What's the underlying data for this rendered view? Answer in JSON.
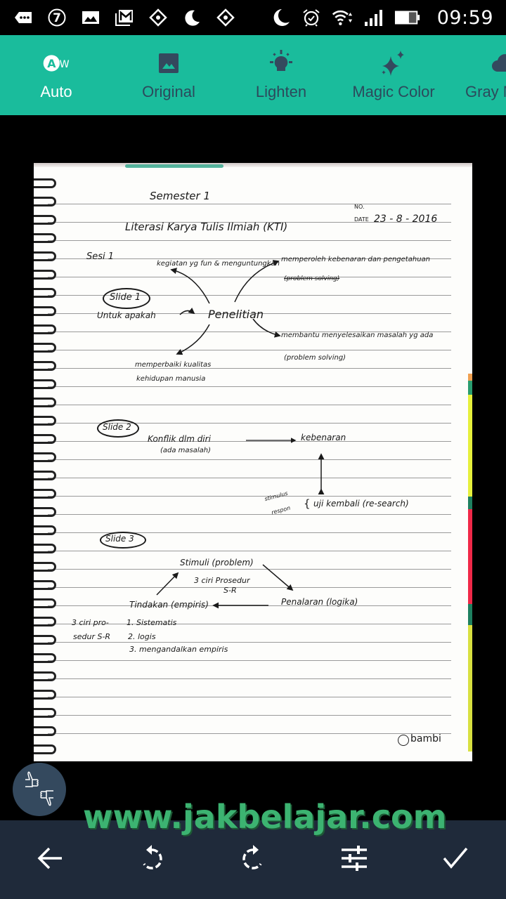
{
  "status_bar": {
    "time": "09:59",
    "left_icons": [
      "chat-more-icon",
      "notification-7-icon",
      "gallery-icon",
      "gmail-icon",
      "diamond-app-icon",
      "night-mode-icon",
      "diamond-app-icon"
    ],
    "right_icons": [
      "night-mode-icon",
      "alarm-icon",
      "wifi-icon",
      "signal-icon",
      "battery-icon"
    ],
    "notification_badge": "7"
  },
  "filter_bar": {
    "items": [
      {
        "label": "Auto",
        "icon": "auto-wb-icon",
        "active": true
      },
      {
        "label": "Original",
        "icon": "image-icon",
        "active": false
      },
      {
        "label": "Lighten",
        "icon": "lightbulb-icon",
        "active": false
      },
      {
        "label": "Magic Color",
        "icon": "sparkle-icon",
        "active": false
      },
      {
        "label": "Gray Mode",
        "icon": "cloud-icon",
        "active": false
      }
    ],
    "active_color": "#ffffff",
    "inactive_color": "#2c4a5c",
    "background": "#1abc9c"
  },
  "document": {
    "header": {
      "title": "Semester 1",
      "subject": "Literasi Karya Tulis Ilmiah (KTI)",
      "no_label": "NO.",
      "date_label": "DATE",
      "date_value": "23 - 8 - 2016"
    },
    "section_label": "Sesi 1",
    "slide1": {
      "label": "Slide 1",
      "center": "Penelitian",
      "question": "Untuk apakah",
      "branches": [
        "kegiatan yg fun & menguntungkan",
        "memperoleh kebenaran dan pengetahuan",
        "(problem solving)",
        "membantu menyelesaikan masalah yg ada",
        "(problem solving)",
        "memperbaiki kualitas",
        "kehidupan manusia"
      ]
    },
    "slide2": {
      "label": "Slide 2",
      "left": "Konflik dlm diri",
      "left_sub": "(ada masalah)",
      "right": "kebenaran",
      "side_note_1": "stimulus",
      "side_note_2": "respon",
      "bottom": "uji kembali (re-search)"
    },
    "slide3": {
      "label": "Slide 3",
      "top": "Stimuli (problem)",
      "center_1": "3 ciri Prosedur",
      "center_2": "S-R",
      "left": "Tindakan (empiris)",
      "right": "Penalaran (logika)",
      "list_title_1": "3 ciri pro-",
      "list_title_2": "sedur S-R",
      "list": [
        "1. Sistematis",
        "2. logis",
        "3. mengandalkan empiris"
      ]
    },
    "brand": "bambi"
  },
  "feedback_button": {
    "icon": "thumbs-up-down-icon"
  },
  "watermark": "www.jakbelajar.com",
  "bottom_bar": {
    "buttons": [
      {
        "name": "back",
        "icon": "arrow-back-icon"
      },
      {
        "name": "rotate-left",
        "icon": "rotate-left-icon"
      },
      {
        "name": "rotate-right",
        "icon": "rotate-right-icon"
      },
      {
        "name": "adjust",
        "icon": "tune-icon"
      },
      {
        "name": "confirm",
        "icon": "check-icon"
      }
    ]
  }
}
